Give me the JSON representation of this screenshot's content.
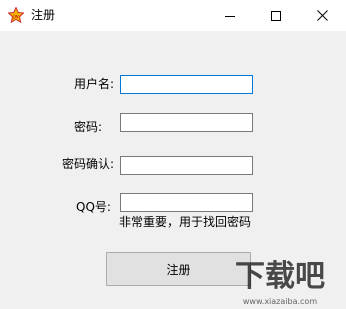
{
  "window": {
    "title": "注册",
    "controls": {
      "minimize_icon": "minimize-icon",
      "maximize_icon": "maximize-icon",
      "close_icon": "close-icon"
    }
  },
  "form": {
    "username_label": "用户名:",
    "username_value": "",
    "password_label": "密码:",
    "password_value": "",
    "confirm_label": "密码确认:",
    "confirm_value": "",
    "qq_label": "QQ号:",
    "qq_value": "",
    "qq_hint": "非常重要，用于找回密码"
  },
  "actions": {
    "register_label": "注册"
  },
  "watermark": {
    "brand": "下载吧",
    "url": "www.xiazaiba.com"
  },
  "colors": {
    "background": "#f0f0f0",
    "titlebar": "#ffffff",
    "focus_border": "#0078d7",
    "field_border": "#7a7a7a",
    "button_bg": "#e1e1e1"
  }
}
